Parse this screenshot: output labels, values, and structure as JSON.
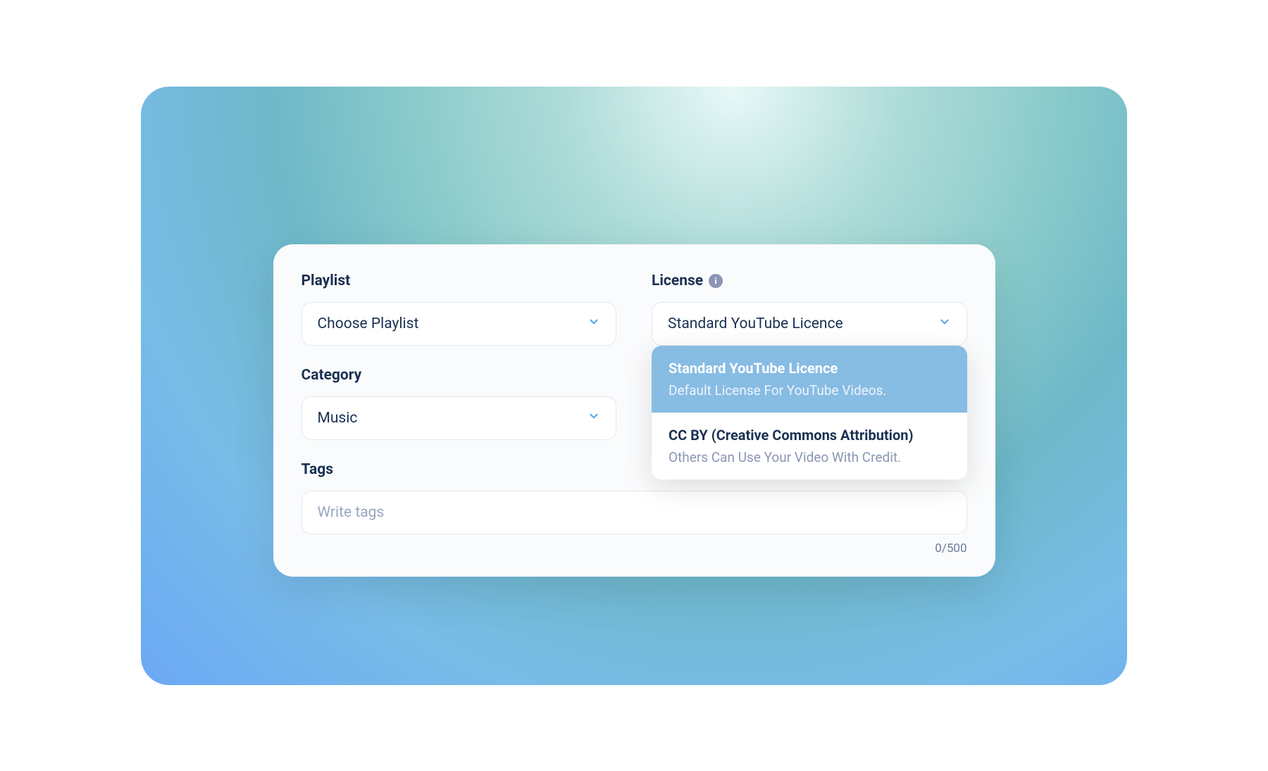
{
  "form": {
    "playlist": {
      "label": "Playlist",
      "value": "Choose Playlist"
    },
    "license": {
      "label": "License",
      "value": "Standard YouTube Licence",
      "options": [
        {
          "title": "Standard YouTube Licence",
          "desc": "Default License For YouTube Videos.",
          "selected": true
        },
        {
          "title": "CC BY (Creative Commons Attribution)",
          "desc": "Others Can Use Your Video With Credit.",
          "selected": false
        }
      ]
    },
    "category": {
      "label": "Category",
      "value": "Music"
    },
    "tags": {
      "label": "Tags",
      "placeholder": "Write tags",
      "counter": "0/500"
    }
  }
}
